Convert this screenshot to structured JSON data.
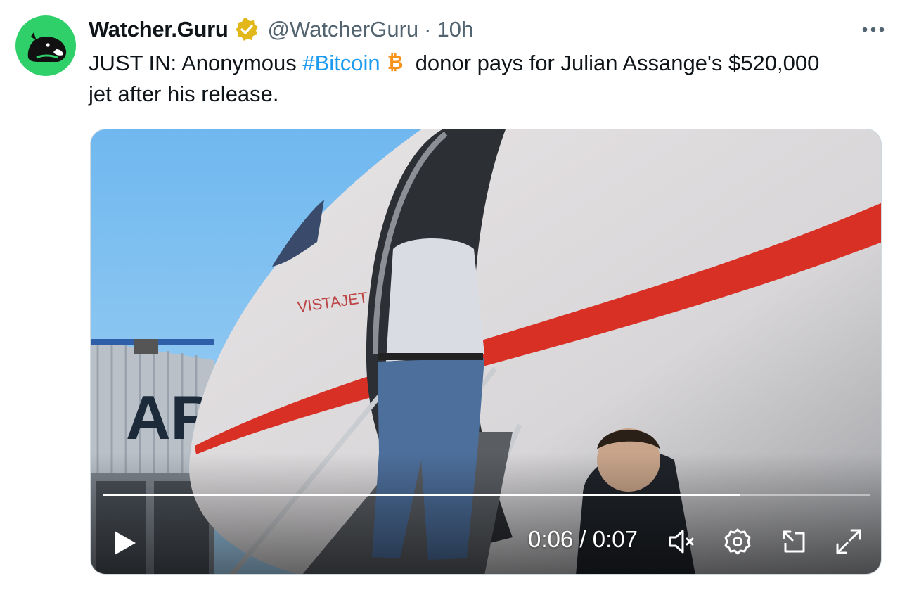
{
  "author": {
    "display_name": "Watcher.Guru",
    "handle": "@WatcherGuru",
    "separator": "·",
    "time_ago": "10h",
    "verified": true
  },
  "tweet": {
    "text_prefix": "JUST IN: Anonymous ",
    "hashtag": "#Bitcoin",
    "text_suffix": "donor pays for Julian Assange's $520,000 jet after his release."
  },
  "video": {
    "time_current": "0:06",
    "time_separator": " / ",
    "time_total": "0:07",
    "progress": 0.83,
    "scene_text": {
      "jet_logo": "VISTAJET",
      "hangar_sign": "AR"
    }
  },
  "icons": {
    "more": "more-horizontal-icon",
    "verified": "verified-badge-icon",
    "bitcoin": "bitcoin-emoji-icon",
    "play": "play-icon",
    "mute": "volume-muted-icon",
    "settings": "gear-icon",
    "pip": "picture-in-picture-icon",
    "fullscreen": "fullscreen-icon"
  },
  "colors": {
    "accent": "#1d9bf0",
    "verified_gold": "#e2b719",
    "avatar_green": "#2fd06a",
    "bitcoin_orange": "#f7931a",
    "secondary_text": "#536471"
  }
}
